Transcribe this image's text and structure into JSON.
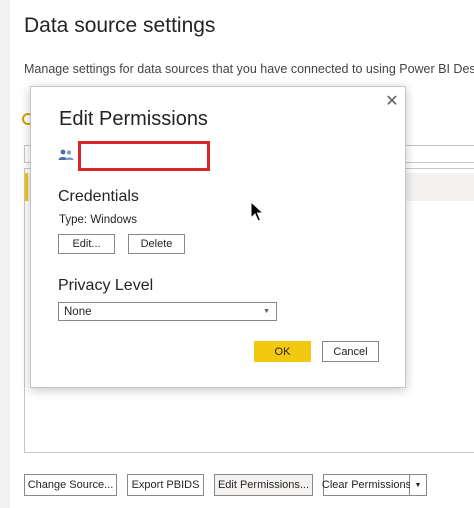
{
  "background": {
    "title": "Data source settings",
    "description": "Manage settings for data sources that you have connected to using Power BI Desktop.",
    "buttons": {
      "change_source": "Change Source...",
      "export_pbids": "Export PBIDS",
      "edit_permissions": "Edit Permissions...",
      "clear_permissions": "Clear Permissions",
      "clear_dropdown_arrow": "▼"
    }
  },
  "dialog": {
    "title": "Edit Permissions",
    "close_glyph": "✕",
    "data_source_value": "",
    "credentials": {
      "heading": "Credentials",
      "type_label": "Type: Windows",
      "edit_label": "Edit...",
      "delete_label": "Delete"
    },
    "privacy": {
      "heading": "Privacy Level",
      "selected": "None",
      "arrow": "▼"
    },
    "ok_label": "OK",
    "cancel_label": "Cancel"
  },
  "colors": {
    "accent": "#f2c811",
    "redaction_border": "#d9252b",
    "people_icon": "#4a6fa5"
  },
  "icons": {
    "people": "people-icon",
    "close": "close-icon",
    "cursor": "cursor-icon"
  }
}
